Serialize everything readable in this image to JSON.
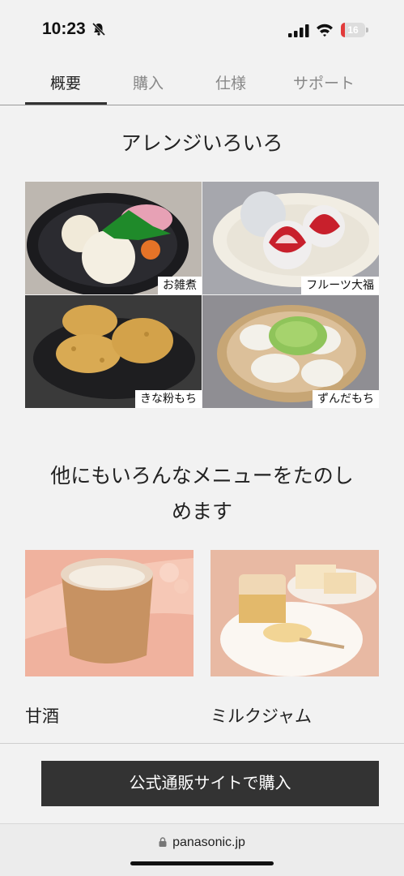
{
  "status_bar": {
    "time": "10:23",
    "battery_level": "16",
    "battery_color": "#e23b3b",
    "icons": [
      "bell-slash-icon",
      "signal-icon",
      "wifi-icon",
      "battery-icon"
    ]
  },
  "tabs": [
    {
      "label": "概要",
      "active": true
    },
    {
      "label": "購入",
      "active": false
    },
    {
      "label": "仕様",
      "active": false
    },
    {
      "label": "サポート",
      "active": false
    }
  ],
  "arrange": {
    "title": "アレンジいろいろ",
    "photos": [
      {
        "caption": "お雑煮"
      },
      {
        "caption": "フルーツ大福"
      },
      {
        "caption": "きな粉もち"
      },
      {
        "caption": "ずんだもち"
      }
    ]
  },
  "menu": {
    "title_line1": "他にもいろんなメニューをたのし",
    "title_line2": "めます",
    "items": [
      {
        "label": "甘酒"
      },
      {
        "label": "ミルクジャム"
      }
    ]
  },
  "buy_button": {
    "label": "公式通販サイトで購入"
  },
  "browser": {
    "url": "panasonic.jp"
  },
  "colors": {
    "accent_dark": "#333333",
    "background": "#f2f2f2"
  }
}
